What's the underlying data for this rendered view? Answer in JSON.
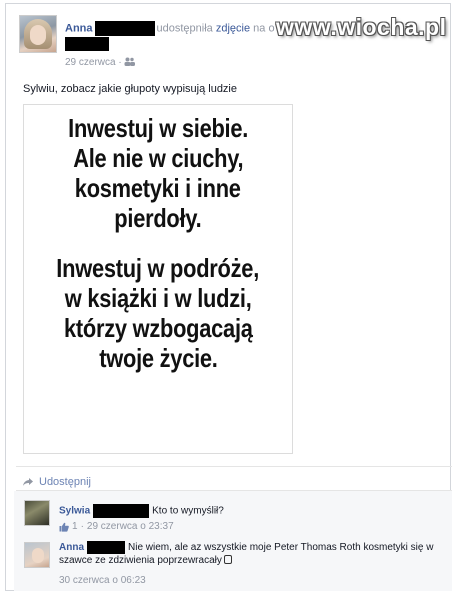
{
  "post": {
    "author": "Anna",
    "action_text": "udostępniła",
    "object_link": "zdjęcie",
    "on_text": "na o",
    "date": "29 czerwca",
    "audience_icon": "friends-icon",
    "caption": "Sylwiu, zobacz jakie głupoty wypisują ludzie"
  },
  "watermark": "www.wiocha.pl",
  "photo_lines": [
    "Inwestuj w siebie.",
    "Ale nie w ciuchy,",
    "kosmetyki i inne",
    "pierdoły.",
    "Inwestuj w podróże,",
    "w książki i w ludzi,",
    "którzy wzbogacają",
    "twoje życie."
  ],
  "share": {
    "label": "Udostępnij",
    "icon": "share-arrow-icon"
  },
  "comments": [
    {
      "author": "Sylwia",
      "text": "Kto to wymyślił?",
      "likes": "1",
      "date": "29 czerwca o 23:37"
    },
    {
      "author": "Anna",
      "text": "Nie wiem, ale az wszystkie moje Peter Thomas Roth kosmetyki się w szawce ze zdziwienia poprzewracały",
      "date": "30 czerwca o 06:23"
    }
  ],
  "colors": {
    "link": "#3b5998",
    "muted": "#9197a3",
    "share": "#6d84b4",
    "comments_bg": "#f6f7f9"
  }
}
